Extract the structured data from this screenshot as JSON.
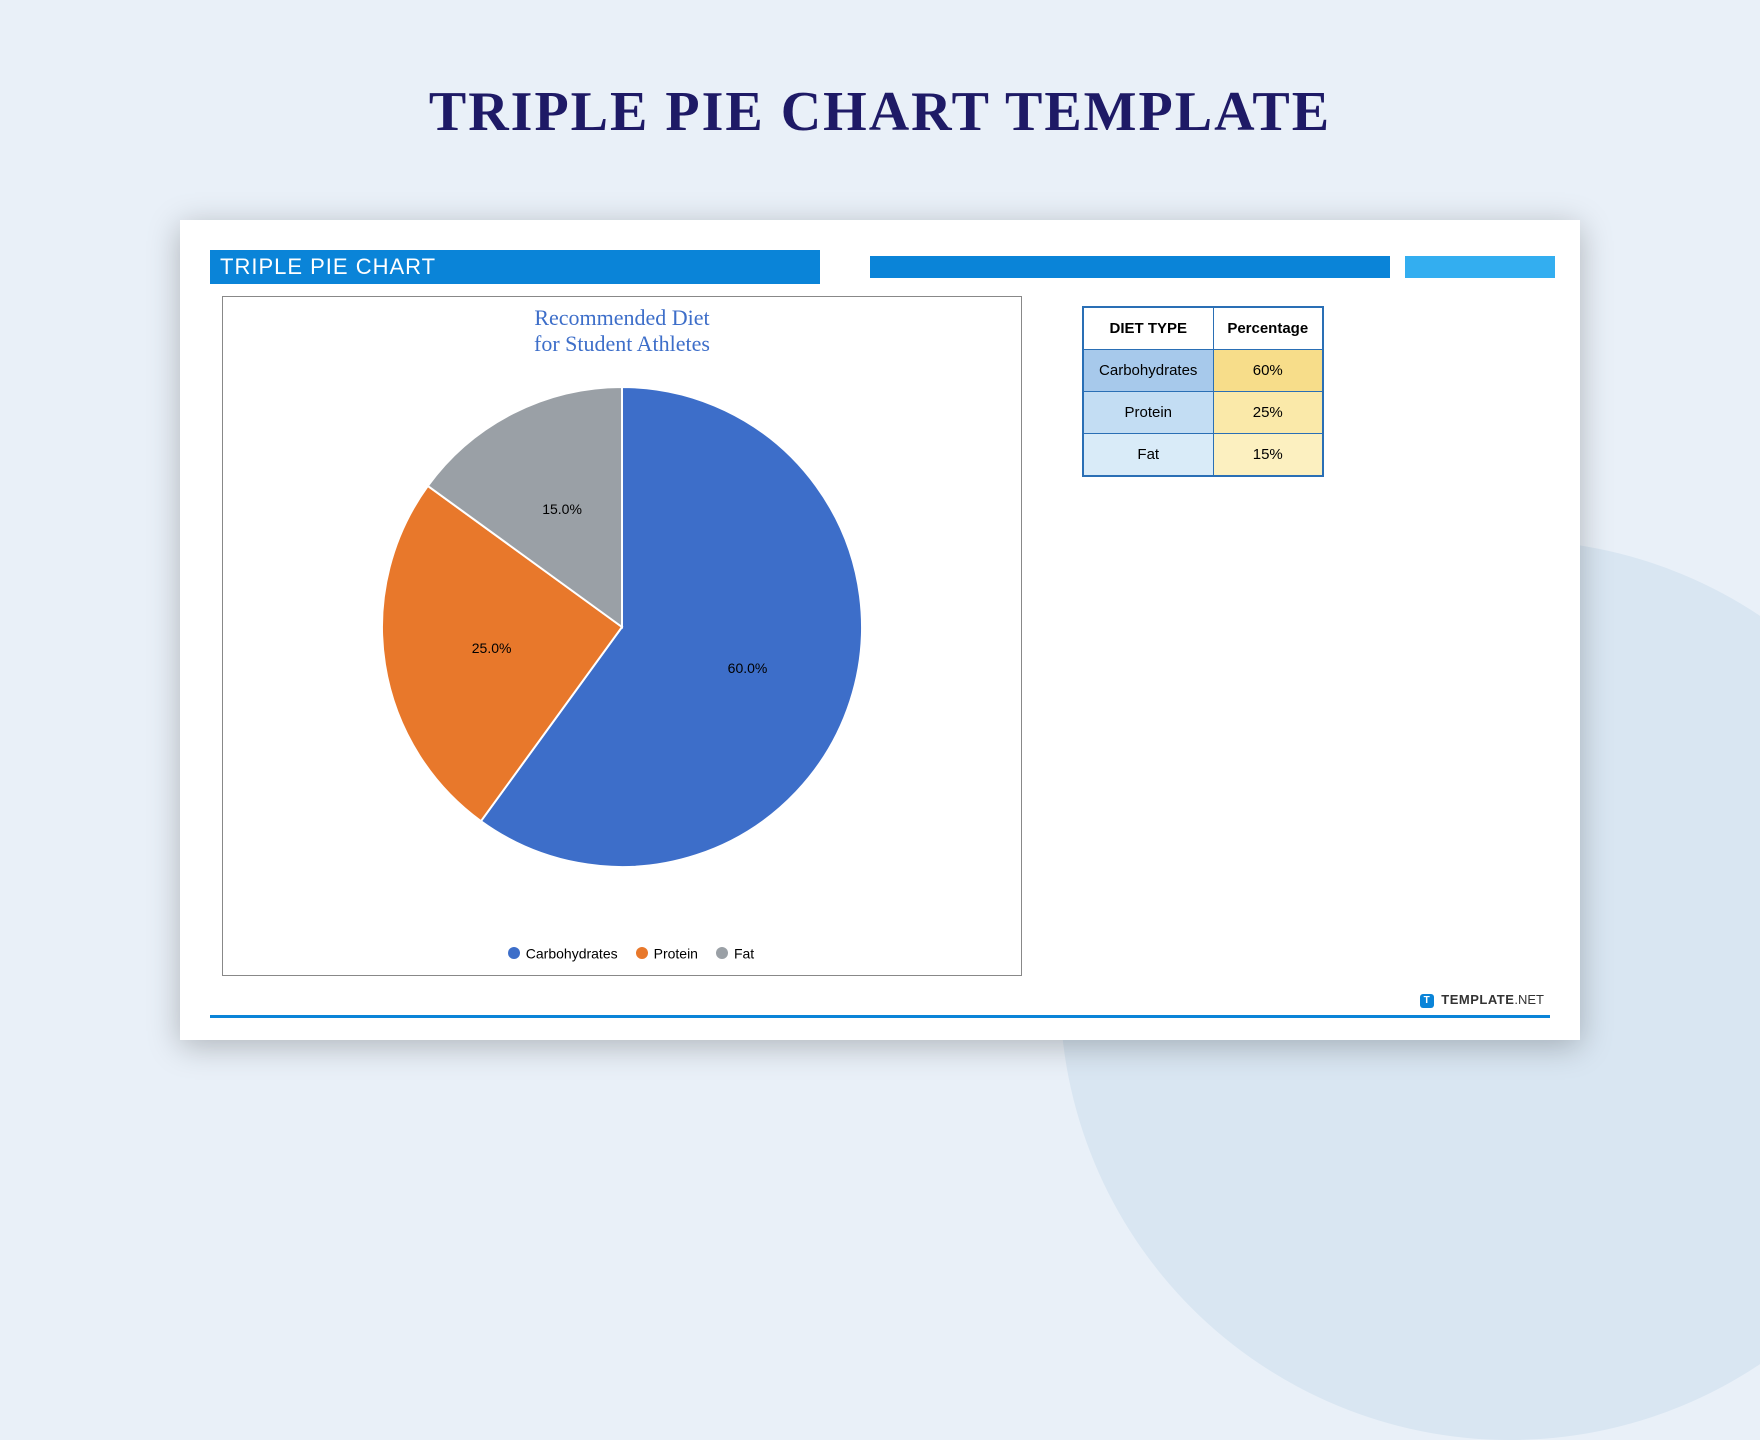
{
  "page": {
    "title": "TRIPLE PIE CHART TEMPLATE"
  },
  "card": {
    "header": "TRIPLE PIE CHART",
    "brand": {
      "logo_letter": "T",
      "name": "TEMPLATE",
      "tld": ".NET"
    }
  },
  "table": {
    "head": {
      "col1": "DIET TYPE",
      "col2": "Percentage"
    },
    "rows": [
      {
        "cat": "Carbohydrates",
        "val": "60%"
      },
      {
        "cat": "Protein",
        "val": "25%"
      },
      {
        "cat": "Fat",
        "val": "15%"
      }
    ]
  },
  "chart_data": {
    "type": "pie",
    "title_line1": "Recommended Diet",
    "title_line2": "for Student Athletes",
    "categories": [
      "Carbohydrates",
      "Protein",
      "Fat"
    ],
    "values": [
      60,
      25,
      15
    ],
    "value_labels": [
      "60.0%",
      "25.0%",
      "15.0%"
    ],
    "colors": [
      "#3d6ec9",
      "#e8782b",
      "#9aa0a6"
    ]
  }
}
